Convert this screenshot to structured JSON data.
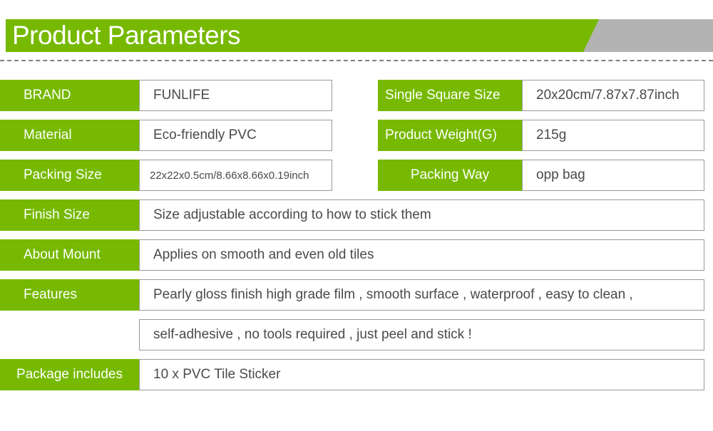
{
  "header": {
    "title": "Product Parameters",
    "banner_color": "#76b900",
    "accent_gray": "#b3b3b3"
  },
  "table": {
    "paired_rows": [
      {
        "left": {
          "label": "BRAND",
          "value": "FUNLIFE"
        },
        "right": {
          "label": "Single Square Size",
          "value": "20x20cm/7.87x7.87inch"
        }
      },
      {
        "left": {
          "label": "Material",
          "value": "Eco-friendly PVC"
        },
        "right": {
          "label": "Product Weight(G)",
          "value": "215g"
        }
      },
      {
        "left": {
          "label": "Packing Size",
          "value": "22x22x0.5cm/8.66x8.66x0.19inch"
        },
        "right": {
          "label": "Packing Way",
          "value": "opp bag"
        }
      }
    ],
    "full_rows": [
      {
        "label": "Finish Size",
        "value": "Size adjustable according to how to stick them"
      },
      {
        "label": "About Mount",
        "value": "Applies on smooth and even old tiles"
      },
      {
        "label": "Features",
        "value": "Pearly gloss finish high grade film , smooth surface , waterproof , easy to clean ,"
      },
      {
        "label": "",
        "value": "self-adhesive , no tools required , just peel and stick !"
      },
      {
        "label": "Package includes",
        "value": "10 x PVC Tile Sticker"
      }
    ]
  }
}
